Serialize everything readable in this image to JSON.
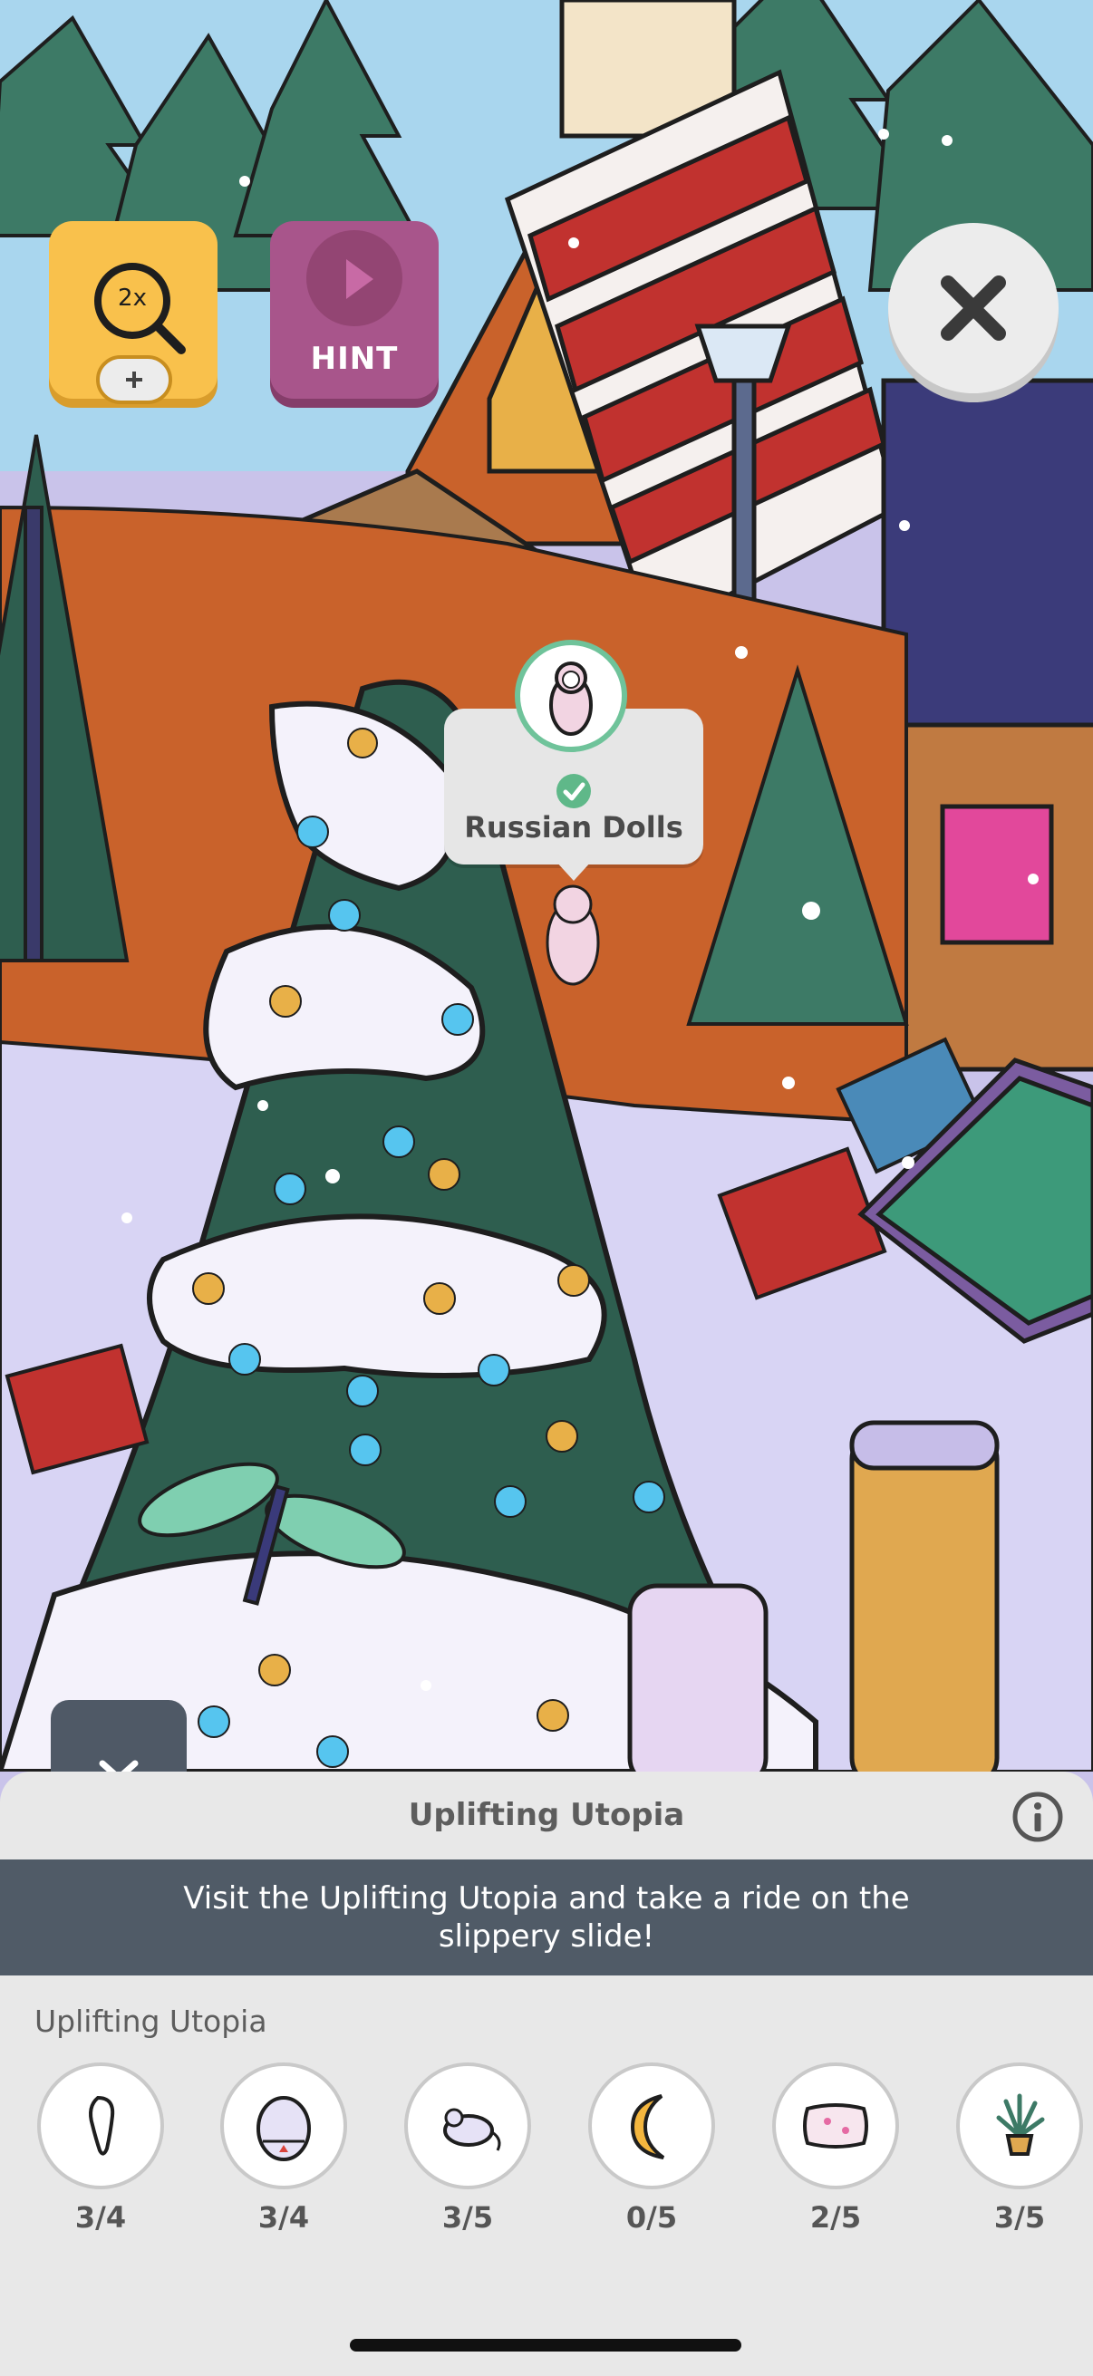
{
  "top_buttons": {
    "zoom_text": "2x",
    "hint_label": "HINT"
  },
  "tooltip": {
    "label": "Russian Dolls"
  },
  "panel": {
    "title": "Uplifting Utopia",
    "banner_text": "Visit the Uplifting Utopia and take a ride on the slippery slide!",
    "section_label": "Uplifting Utopia",
    "items": [
      {
        "icon": "tooth-icon",
        "count": "3/4"
      },
      {
        "icon": "egg-timer-icon",
        "count": "3/4"
      },
      {
        "icon": "mouse-icon",
        "count": "3/5"
      },
      {
        "icon": "moon-icon",
        "count": "0/5"
      },
      {
        "icon": "pillow-icon",
        "count": "2/5"
      },
      {
        "icon": "potted-plant-icon",
        "count": "3/5"
      }
    ]
  },
  "colors": {
    "zoom_button": "#f9c14c",
    "hint_button": "#a8558b",
    "banner": "#505b67",
    "panel_bg": "#e8e8e8",
    "snow_ground": "#c9c3ea",
    "tree_green": "#2e5e4f",
    "check_green": "#5fb889"
  }
}
